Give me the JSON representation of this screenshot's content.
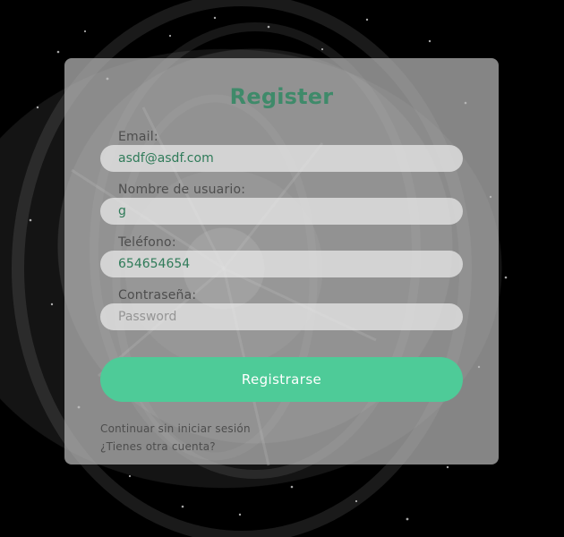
{
  "page": {
    "title": "Register"
  },
  "form": {
    "email": {
      "label": "Email:",
      "value": "asdf@asdf.com"
    },
    "username": {
      "label": "Nombre de usuario:",
      "value": "g"
    },
    "phone": {
      "label": "Teléfono:",
      "value": "654654654"
    },
    "password": {
      "label": "Contraseña:",
      "placeholder": "Password"
    },
    "submit_label": "Registrarse"
  },
  "links": {
    "continue": "Continuar sin iniciar sesión",
    "account": "¿Tienes otra cuenta?"
  },
  "colors": {
    "accent": "#4ecb98",
    "title": "#3f8a6a",
    "text": "#2f7b59",
    "label": "#4d4d4d",
    "card": "#bebebe"
  }
}
